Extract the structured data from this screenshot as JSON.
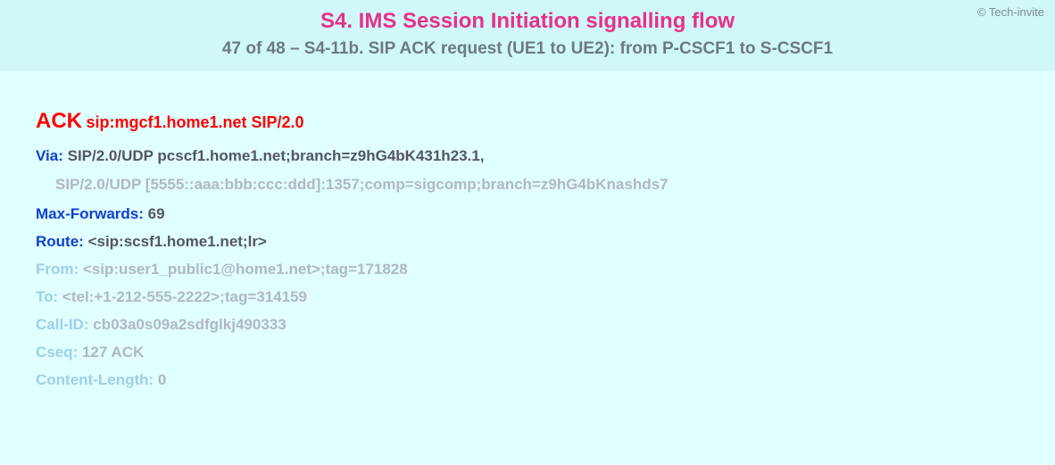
{
  "copyright": "© Tech-invite",
  "title": "S4. IMS Session Initiation signalling flow",
  "subtitle": "47 of 48 – S4-11b. SIP ACK request (UE1 to UE2): from P-CSCF1 to S-CSCF1",
  "request": {
    "method": "ACK",
    "uri": "sip:mgcf1.home1.net SIP/2.0"
  },
  "headers": {
    "via": {
      "name": "Via:",
      "value1": "SIP/2.0/UDP pcscf1.home1.net;branch=z9hG4bK431h23.1,",
      "value2": "SIP/2.0/UDP [5555::aaa:bbb:ccc:ddd]:1357;comp=sigcomp;branch=z9hG4bKnashds7"
    },
    "maxforwards": {
      "name": "Max-Forwards:",
      "value": "69"
    },
    "route": {
      "name": "Route:",
      "value": "<sip:scsf1.home1.net;lr>"
    },
    "from": {
      "name": "From:",
      "value": "<sip:user1_public1@home1.net>;tag=171828"
    },
    "to": {
      "name": "To:",
      "value": "<tel:+1-212-555-2222>;tag=314159"
    },
    "callid": {
      "name": "Call-ID:",
      "value": "cb03a0s09a2sdfglkj490333"
    },
    "cseq": {
      "name": "Cseq:",
      "value": "127 ACK"
    },
    "contentlength": {
      "name": "Content-Length:",
      "value": "0"
    }
  }
}
